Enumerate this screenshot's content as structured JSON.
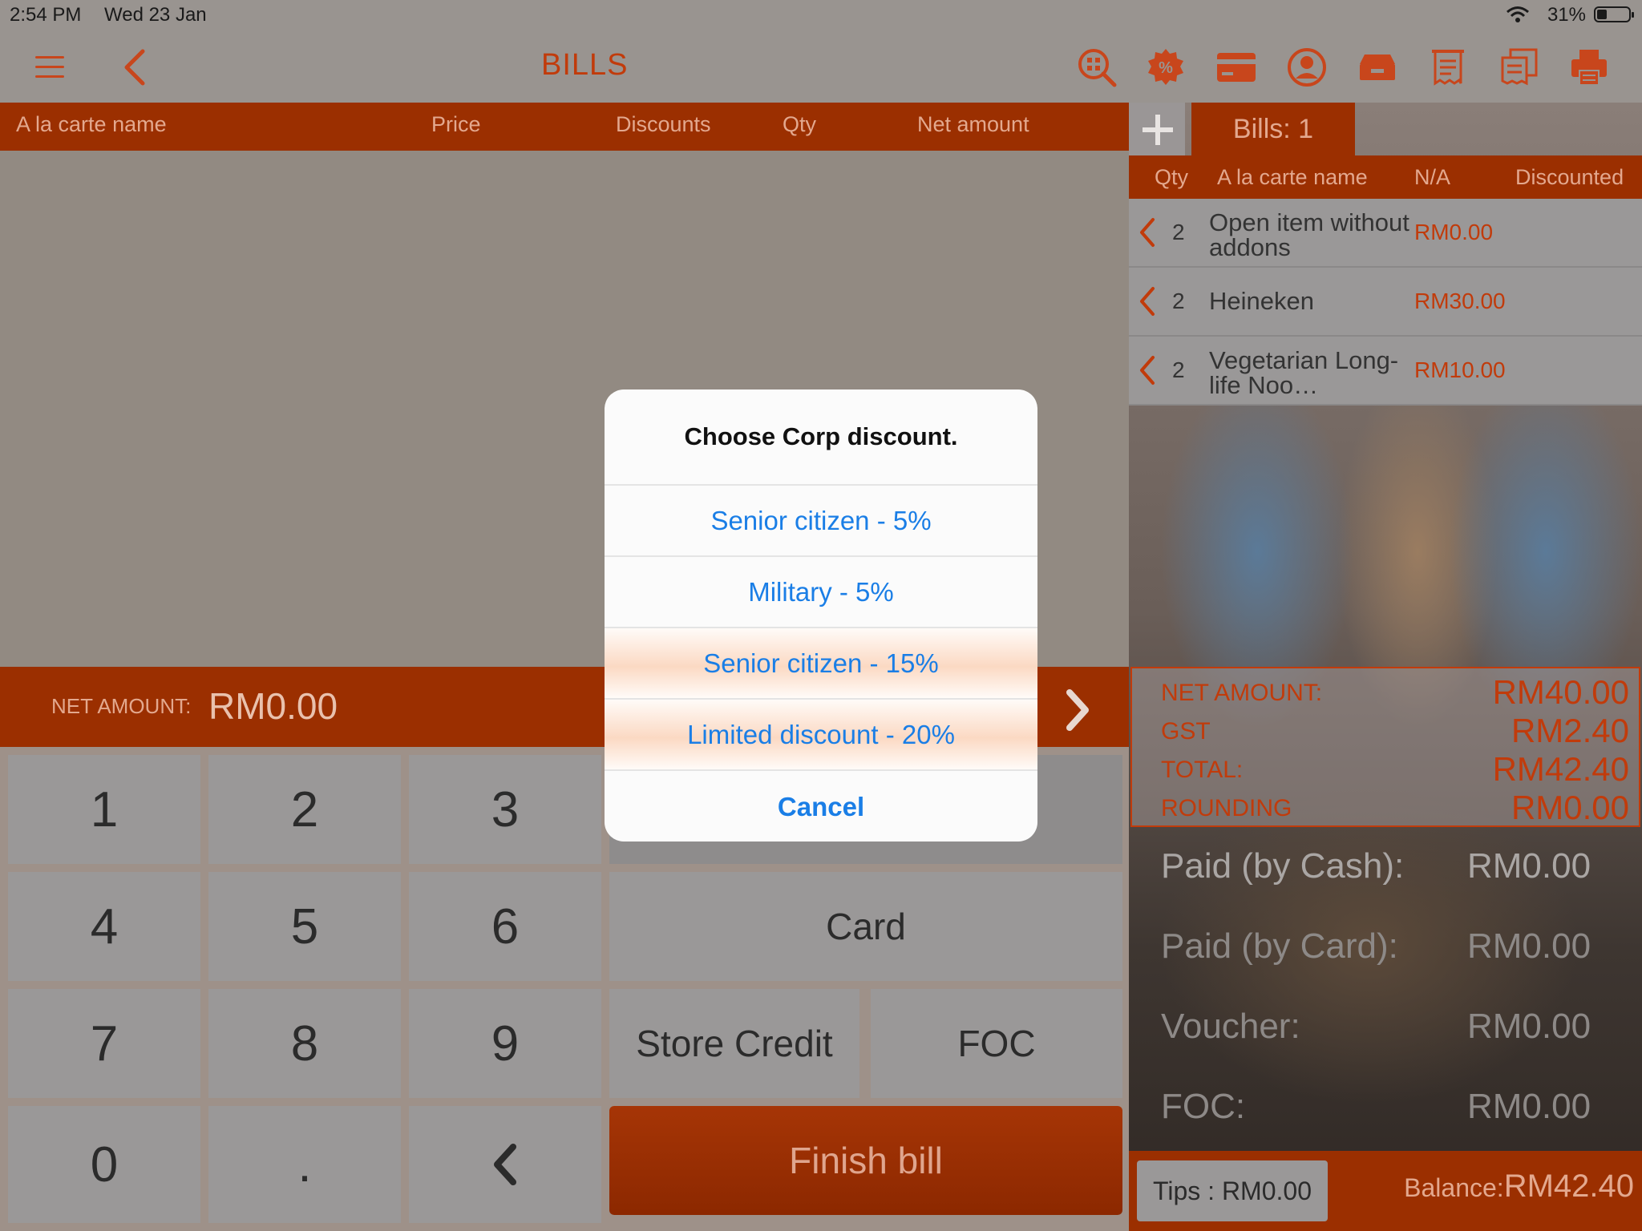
{
  "status_bar": {
    "time": "2:54 PM",
    "date": "Wed 23 Jan",
    "battery": "31%"
  },
  "nav": {
    "title": "BILLS",
    "icons": [
      "menu-icon",
      "back-icon",
      "qr-search-icon",
      "discount-badge-icon",
      "card-icon",
      "customer-icon",
      "cash-drawer-icon",
      "receipt-icon",
      "receipts-icon",
      "printer-icon"
    ]
  },
  "table_header": [
    "A la carte name",
    "Price",
    "Discounts",
    "Qty",
    "Net amount"
  ],
  "net_bar": {
    "label": "NET AMOUNT:",
    "value": "RM0.00"
  },
  "keypad": {
    "digits": [
      "1",
      "2",
      "3",
      "4",
      "5",
      "6",
      "7",
      "8",
      "9",
      "0",
      "."
    ],
    "card": "Card",
    "store_credit": "Store Credit",
    "foc": "FOC",
    "finish": "Finish bill"
  },
  "right_panel": {
    "bills_tab": "Bills: 1",
    "headers": [
      "Qty",
      "A la carte name",
      "N/A",
      "Discounted"
    ],
    "items": [
      {
        "qty": "2",
        "name": "Open item without addons",
        "amount": "RM0.00"
      },
      {
        "qty": "2",
        "name": "Heineken",
        "amount": "RM30.00"
      },
      {
        "qty": "2",
        "name": "Vegetarian Long-life Noo…",
        "amount": "RM10.00"
      }
    ],
    "summary": [
      {
        "label": "NET AMOUNT:",
        "value": "RM40.00"
      },
      {
        "label": "GST",
        "value": "RM2.40"
      },
      {
        "label": "TOTAL:",
        "value": "RM42.40"
      },
      {
        "label": "ROUNDING",
        "value": "RM0.00"
      }
    ],
    "payments": [
      {
        "label": "Paid (by Cash):",
        "value": "RM0.00"
      },
      {
        "label": "Paid (by Card):",
        "value": "RM0.00"
      },
      {
        "label": "Voucher:",
        "value": "RM0.00"
      },
      {
        "label": "FOC:",
        "value": "RM0.00"
      }
    ],
    "tips": "Tips : RM0.00",
    "balance_label": "Balance:",
    "balance_value": "RM42.40"
  },
  "dialog": {
    "title": "Choose Corp discount.",
    "options": [
      "Senior citizen - 5%",
      "Military - 5%",
      "Senior citizen - 15%",
      "Limited discount - 20%"
    ],
    "cancel": "Cancel"
  },
  "colors": {
    "accent": "#9b2f00",
    "accent_text": "#c13b0b",
    "dialog_link": "#1a7ee6"
  }
}
